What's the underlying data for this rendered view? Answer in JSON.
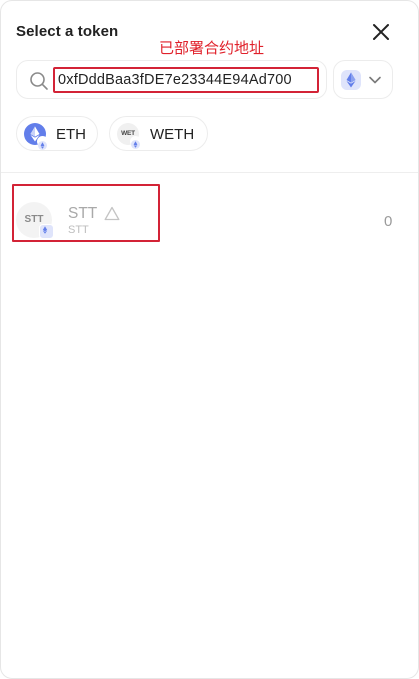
{
  "header": {
    "title": "Select a token",
    "close_icon": "close-icon"
  },
  "annotation": {
    "text": "已部署合约地址",
    "color": "#e0202a"
  },
  "search": {
    "value": "0xfDddBaa3fDE7e23344E94Ad700",
    "icon": "search-icon"
  },
  "network_selector": {
    "icon": "ethereum-icon",
    "chevron": "chevron-down-icon"
  },
  "common_tokens": [
    {
      "symbol": "ETH",
      "icon": "eth-token-icon"
    },
    {
      "symbol": "WETH",
      "icon_text": "WET",
      "icon": "weth-token-icon"
    }
  ],
  "token_list": [
    {
      "name": "STT",
      "symbol": "STT",
      "logo_text": "STT",
      "balance": "0",
      "warning_icon": "warning-icon"
    }
  ],
  "colors": {
    "highlight_border": "#d32336",
    "eth_blue": "#627eea",
    "chain_badge_bg": "#dfe4fb"
  }
}
